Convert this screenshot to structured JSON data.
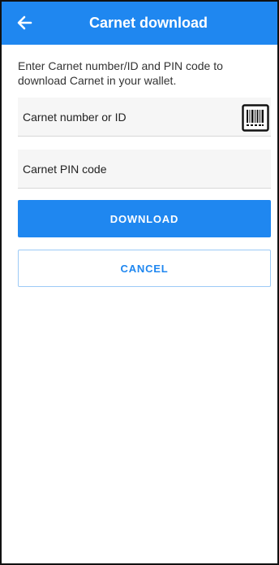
{
  "header": {
    "title": "Carnet download",
    "back_icon": "arrow-left-icon",
    "color": "#1f87f0"
  },
  "instructions": "Enter Carnet number/ID and PIN code to download Carnet in your wallet.",
  "form": {
    "carnet_number": {
      "placeholder": "Carnet number or ID",
      "value": ""
    },
    "scan_icon": "barcode-scan-icon",
    "pin": {
      "placeholder": "Carnet PIN code",
      "value": ""
    }
  },
  "actions": {
    "download_label": "DOWNLOAD",
    "cancel_label": "CANCEL"
  }
}
